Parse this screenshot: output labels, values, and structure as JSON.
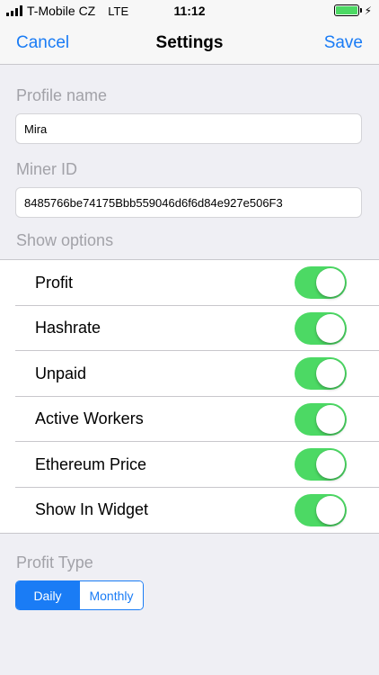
{
  "status_bar": {
    "carrier": "T-Mobile CZ",
    "network": "LTE",
    "time": "11:12",
    "battery_level": 1.0,
    "battery_color": "#4cd964"
  },
  "nav": {
    "cancel_label": "Cancel",
    "title": "Settings",
    "save_label": "Save"
  },
  "profile": {
    "label": "Profile name",
    "value": "Mira"
  },
  "miner": {
    "label": "Miner ID",
    "value": "8485766be74175Bbb559046d6f6d84e927e506F3"
  },
  "show_options": {
    "label": "Show options",
    "items": [
      {
        "label": "Profit",
        "on": true
      },
      {
        "label": "Hashrate",
        "on": true
      },
      {
        "label": "Unpaid",
        "on": true
      },
      {
        "label": "Active Workers",
        "on": true
      },
      {
        "label": "Ethereum Price",
        "on": true
      },
      {
        "label": "Show In Widget",
        "on": true
      }
    ]
  },
  "profit_type": {
    "label": "Profit Type",
    "options": [
      "Daily",
      "Monthly"
    ],
    "selected": "Daily"
  },
  "colors": {
    "accent": "#1a7cf5",
    "toggle_on": "#4cd964",
    "background": "#efeff4",
    "secondary_text": "#a2a2a8"
  },
  "icons": {
    "signal": "signal-bars-icon",
    "battery": "battery-icon",
    "charging": "charging-bolt-icon"
  }
}
